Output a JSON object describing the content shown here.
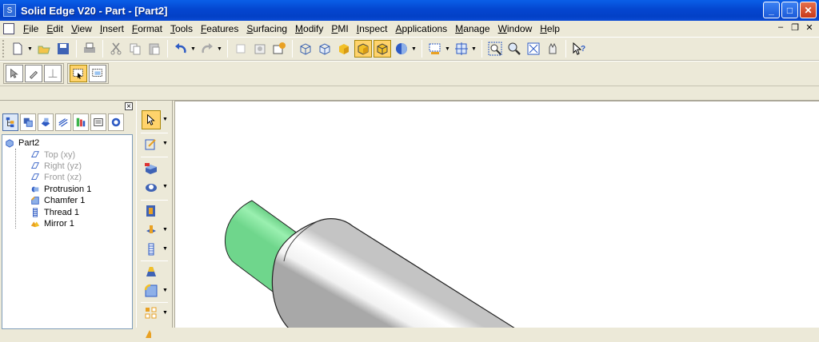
{
  "window": {
    "title": "Solid Edge V20 - Part - [Part2]"
  },
  "title_buttons": {
    "minimize": "_",
    "maximize": "□",
    "close": "✕"
  },
  "menu": [
    "File",
    "Edit",
    "View",
    "Insert",
    "Format",
    "Tools",
    "Features",
    "Surfacing",
    "Modify",
    "PMI",
    "Inspect",
    "Applications",
    "Manage",
    "Window",
    "Help"
  ],
  "mdi_buttons": {
    "minimize": "–",
    "restore": "❐",
    "close": "✕"
  },
  "toolbar_icons": [
    "new-icon",
    "open-icon",
    "save-icon",
    "print-icon",
    "cut-icon",
    "copy-icon",
    "paste-icon",
    "undo-icon",
    "redo-icon",
    "copy-model-icon",
    "properties-icon",
    "render-icon",
    "shaded-icon",
    "wireframe-icon",
    "visible-edges-icon",
    "shaded-box-icon",
    "shaded-visible-icon",
    "view-orient-icon",
    "select-icon",
    "fit-icon",
    "zoom-area-icon",
    "zoom-icon",
    "fit-all-icon",
    "pan-icon",
    "whats-this-icon"
  ],
  "pane": {
    "close": "×",
    "tabs": [
      "edgebar-tree-icon",
      "layers-icon",
      "feature-library-icon",
      "family-icon",
      "sensors-icon",
      "selection-manager-icon",
      "parts-icon"
    ]
  },
  "tree": {
    "root": "Part2",
    "items": [
      {
        "label": "Top (xy)",
        "icon": "plane-icon",
        "state": "hidden"
      },
      {
        "label": "Right (yz)",
        "icon": "plane-icon",
        "state": "hidden"
      },
      {
        "label": "Front (xz)",
        "icon": "plane-icon",
        "state": "hidden"
      },
      {
        "label": "Protrusion 1",
        "icon": "protrusion-icon",
        "state": "shown"
      },
      {
        "label": "Chamfer 1",
        "icon": "chamfer-icon",
        "state": "shown"
      },
      {
        "label": "Thread 1",
        "icon": "thread-icon",
        "state": "shown"
      },
      {
        "label": "Mirror 1",
        "icon": "mirror-icon",
        "state": "shown"
      }
    ]
  },
  "colors": {
    "accent": "#FFD36B",
    "thread_face": "#7FE39A",
    "titlebar": "#0446D0"
  }
}
